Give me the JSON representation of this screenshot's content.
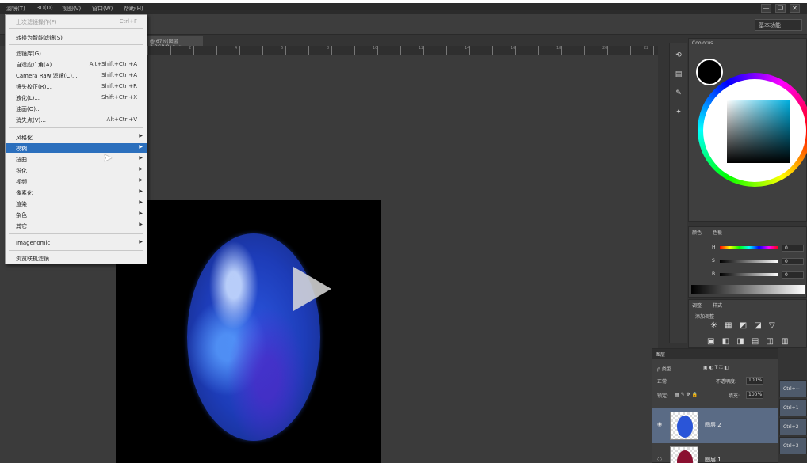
{
  "menubar": {
    "items": [
      "滤镜(T)",
      "3D(D)",
      "视图(V)",
      "窗口(W)",
      "帮助(H)"
    ],
    "window_buttons": [
      "—",
      "❐",
      "✕"
    ]
  },
  "optionsbar": {
    "workspace": "基本功能"
  },
  "document": {
    "tab_label": "@ 67%(图层 2,RGB/8) *",
    "close": "×",
    "ruler_ticks": [
      "2",
      "4",
      "6",
      "8",
      "10",
      "12",
      "14",
      "16",
      "18",
      "20",
      "22"
    ]
  },
  "filter_menu": {
    "items": [
      {
        "label": "上次滤镜操作(F)",
        "shortcut": "Ctrl+F",
        "state": "dim"
      },
      {
        "label": "转换为智能滤镜(S)",
        "shortcut": "",
        "state": "normal"
      },
      {
        "label": "滤镜库(G)...",
        "shortcut": "",
        "state": "normal"
      },
      {
        "label": "自适应广角(A)...",
        "shortcut": "Alt+Shift+Ctrl+A",
        "state": "normal"
      },
      {
        "label": "Camera Raw 滤镜(C)...",
        "shortcut": "Shift+Ctrl+A",
        "state": "normal"
      },
      {
        "label": "镜头校正(R)...",
        "shortcut": "Shift+Ctrl+R",
        "state": "normal"
      },
      {
        "label": "液化(L)...",
        "shortcut": "Shift+Ctrl+X",
        "state": "normal"
      },
      {
        "label": "油画(O)...",
        "shortcut": "",
        "state": "normal"
      },
      {
        "label": "消失点(V)...",
        "shortcut": "Alt+Ctrl+V",
        "state": "normal"
      },
      {
        "label": "风格化",
        "shortcut": "",
        "state": "submenu"
      },
      {
        "label": "模糊",
        "shortcut": "",
        "state": "highlighted"
      },
      {
        "label": "扭曲",
        "shortcut": "",
        "state": "submenu"
      },
      {
        "label": "锐化",
        "shortcut": "",
        "state": "submenu"
      },
      {
        "label": "视频",
        "shortcut": "",
        "state": "submenu"
      },
      {
        "label": "像素化",
        "shortcut": "",
        "state": "submenu"
      },
      {
        "label": "渲染",
        "shortcut": "",
        "state": "submenu"
      },
      {
        "label": "杂色",
        "shortcut": "",
        "state": "submenu"
      },
      {
        "label": "其它",
        "shortcut": "",
        "state": "submenu"
      },
      {
        "label": "Imagenomic",
        "shortcut": "",
        "state": "submenu"
      },
      {
        "label": "浏览联机滤镜...",
        "shortcut": "",
        "state": "normal"
      }
    ],
    "submenu_arrow": "▶"
  },
  "color_panel": {
    "tab": "Coolorus",
    "slider_tabs": [
      "颜色",
      "色板"
    ],
    "sliders": [
      {
        "label": "H",
        "value": "0"
      },
      {
        "label": "S",
        "value": "0"
      },
      {
        "label": "B",
        "value": "0"
      }
    ]
  },
  "adjust_panel": {
    "tabs": [
      "调整",
      "样式"
    ],
    "title": "添加调整",
    "icons_row1": "☀ ▦ ◩ ◪ ▽",
    "icons_row2": "▣ ◧ ◨ ▤ ◫ ▥"
  },
  "layers_panel": {
    "tab": "图层",
    "filter": "ρ 类型",
    "blend_mode": "正常",
    "opacity_label": "不透明度:",
    "opacity_value": "100%",
    "lock_label": "锁定:",
    "fill_label": "填充:",
    "fill_value": "100%",
    "layers": [
      {
        "name": "图层 2",
        "selected": true,
        "thumb_color": "#2a55d8"
      },
      {
        "name": "图层 1",
        "selected": false,
        "thumb_color": "#8a1030"
      }
    ],
    "eye": "👁"
  },
  "shortcut_buttons": [
    "Ctrl+~",
    "Ctrl+1",
    "Ctrl+2",
    "Ctrl+3"
  ],
  "player": {
    "play_icon": "play-icon"
  }
}
